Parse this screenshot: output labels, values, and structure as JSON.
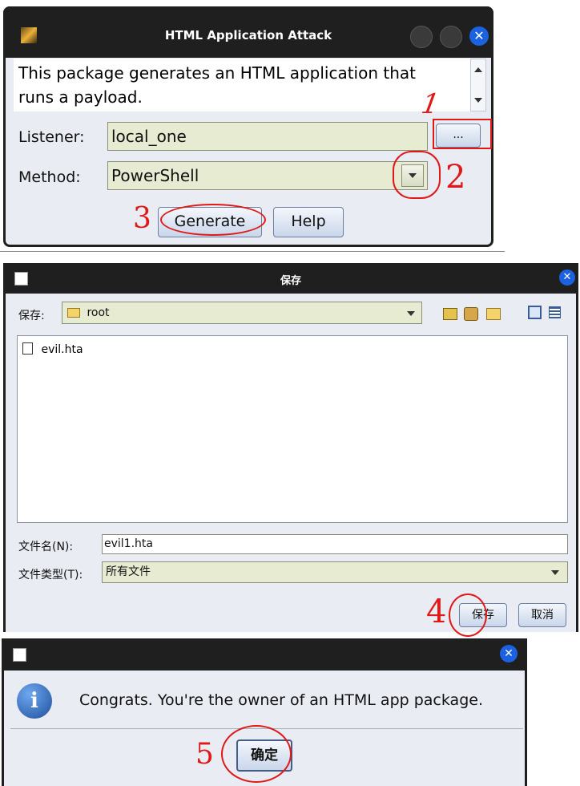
{
  "dialog1": {
    "title": "HTML Application Attack",
    "description_line1": "This package generates an HTML application that",
    "description_line2": "runs a payload.",
    "listener_label": "Listener:",
    "listener_value": "local_one",
    "browse_label": "...",
    "method_label": "Method:",
    "method_value": "PowerShell",
    "generate_label": "Generate",
    "help_label": "Help"
  },
  "dialog2": {
    "title": "保存",
    "save_in_label": "保存:",
    "folder_value": "root",
    "files": [
      "evil.hta"
    ],
    "filename_label": "文件名(N):",
    "filename_value": "evil1.hta",
    "filetype_label": "文件类型(T):",
    "filetype_value": "所有文件",
    "save_label": "保存",
    "cancel_label": "取消"
  },
  "dialog3": {
    "message": "Congrats. You're the owner of an HTML app package.",
    "ok_label": "确定"
  },
  "annotations": {
    "step1": "1",
    "step2": "2",
    "step3": "3",
    "step4": "4",
    "step5": "5"
  }
}
